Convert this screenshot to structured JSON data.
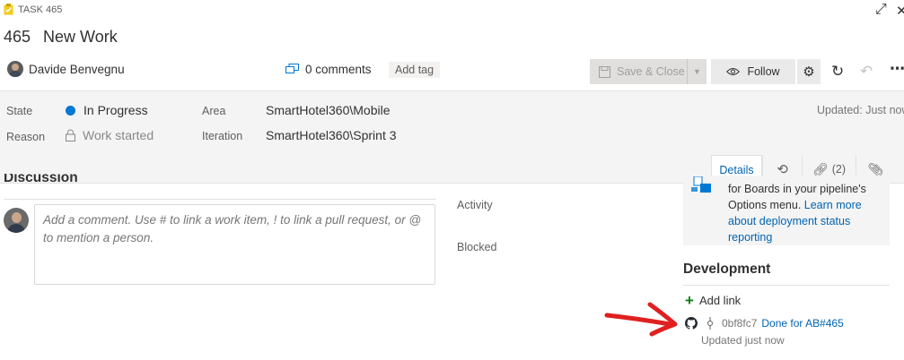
{
  "header": {
    "work_item_type": "TASK 465",
    "id": "465",
    "title": "New Work",
    "assigned_to": "Davide Benvegnu",
    "comments_count": "0 comments",
    "add_tag_label": "Add tag"
  },
  "toolbar": {
    "save_close_label": "Save & Close",
    "follow_label": "Follow"
  },
  "fields": {
    "state_label": "State",
    "state_value": "In Progress",
    "state_color": "#0078d4",
    "reason_label": "Reason",
    "reason_value": "Work started",
    "area_label": "Area",
    "area_value": "SmartHotel360\\Mobile",
    "iteration_label": "Iteration",
    "iteration_value": "SmartHotel360\\Sprint 3",
    "updated_text": "Updated: Just now"
  },
  "tabs": {
    "details": "Details",
    "links_count": "(2)"
  },
  "discussion": {
    "heading": "Discussion",
    "placeholder": "Add a comment. Use # to link a work item, ! to link a pull request, or @ to mention a person."
  },
  "planning": {
    "activity_label": "Activity",
    "blocked_label": "Blocked"
  },
  "deployment_card": {
    "line1": "for Boards in your pipeline's",
    "line2_prefix": "Options menu.",
    "learn_more": "Learn more about deployment status reporting"
  },
  "development": {
    "heading": "Development",
    "add_link_label": "Add link",
    "commit_hash": "0bf8fc7",
    "commit_message": "Done for AB#465",
    "commit_updated": "Updated just now"
  },
  "colors": {
    "accent": "#0078d4",
    "link": "#0063b1",
    "annotation_arrow": "#e02020",
    "add_green": "#107c10"
  }
}
